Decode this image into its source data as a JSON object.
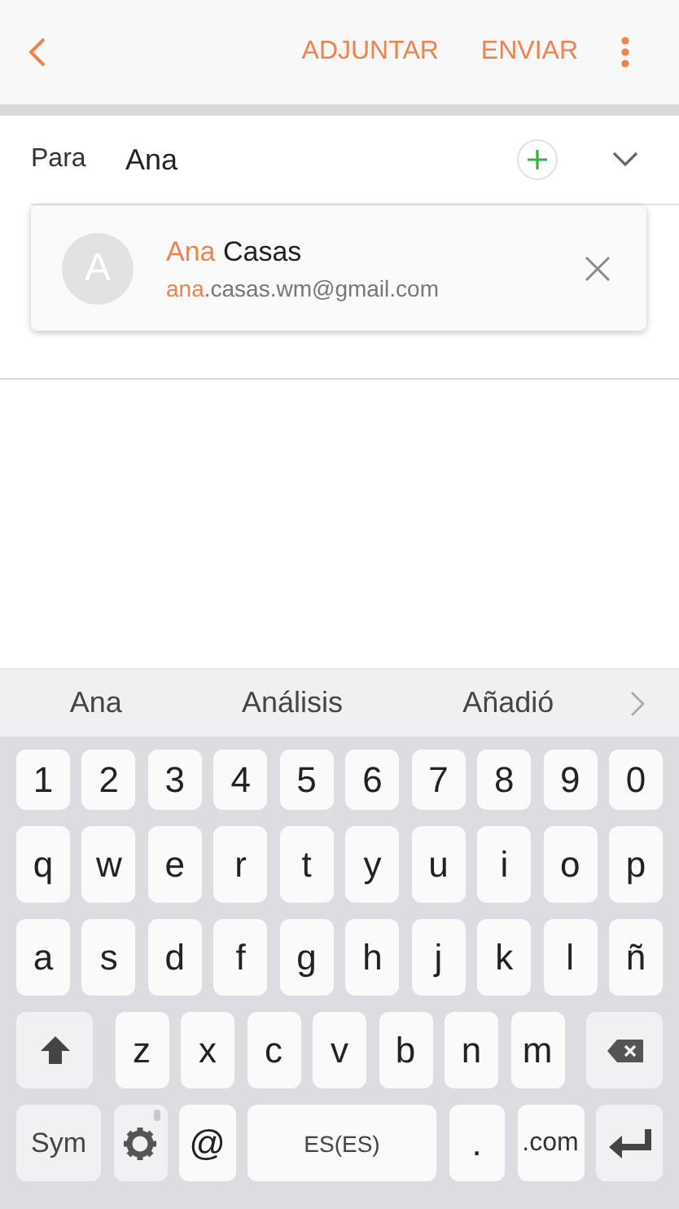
{
  "header": {
    "actions": [
      "ADJUNTAR",
      "ENVIAR"
    ]
  },
  "to": {
    "label": "Para",
    "value": "Ana"
  },
  "suggestion_card": {
    "initial": "A",
    "name_parts": [
      {
        "text": "Ana",
        "highlight": true
      },
      {
        "text": " Casas",
        "highlight": false
      }
    ],
    "email_parts": [
      {
        "text": "ana",
        "highlight": true
      },
      {
        "text": ".casas.wm@gmail.com",
        "highlight": false
      }
    ]
  },
  "predictions": [
    "Ana",
    "Análisis",
    "Añadió"
  ],
  "keyboard": [
    [
      {
        "kind": "num",
        "label": "1"
      },
      {
        "kind": "num",
        "label": "2"
      },
      {
        "kind": "num",
        "label": "3"
      },
      {
        "kind": "num",
        "label": "4"
      },
      {
        "kind": "num",
        "label": "5"
      },
      {
        "kind": "num",
        "label": "6"
      },
      {
        "kind": "num",
        "label": "7"
      },
      {
        "kind": "num",
        "label": "8"
      },
      {
        "kind": "num",
        "label": "9"
      },
      {
        "kind": "num",
        "label": "0"
      }
    ],
    [
      {
        "kind": "char",
        "label": "q"
      },
      {
        "kind": "char",
        "label": "w"
      },
      {
        "kind": "char",
        "label": "e"
      },
      {
        "kind": "char",
        "label": "r"
      },
      {
        "kind": "char",
        "label": "t"
      },
      {
        "kind": "char",
        "label": "y"
      },
      {
        "kind": "char",
        "label": "u"
      },
      {
        "kind": "char",
        "label": "i"
      },
      {
        "kind": "char",
        "label": "o"
      },
      {
        "kind": "char",
        "label": "p"
      }
    ],
    [
      {
        "kind": "char",
        "label": "a"
      },
      {
        "kind": "char",
        "label": "s"
      },
      {
        "kind": "char",
        "label": "d"
      },
      {
        "kind": "char",
        "label": "f"
      },
      {
        "kind": "char",
        "label": "g"
      },
      {
        "kind": "char",
        "label": "h"
      },
      {
        "kind": "char",
        "label": "j"
      },
      {
        "kind": "char",
        "label": "k"
      },
      {
        "kind": "char",
        "label": "l"
      },
      {
        "kind": "char",
        "label": "ñ"
      }
    ],
    [
      {
        "kind": "shift"
      },
      {
        "kind": "char",
        "label": "z"
      },
      {
        "kind": "char",
        "label": "x"
      },
      {
        "kind": "char",
        "label": "c"
      },
      {
        "kind": "char",
        "label": "v"
      },
      {
        "kind": "char",
        "label": "b"
      },
      {
        "kind": "char",
        "label": "n"
      },
      {
        "kind": "char",
        "label": "m"
      },
      {
        "kind": "backspace"
      }
    ],
    [
      {
        "kind": "sym",
        "label": "Sym"
      },
      {
        "kind": "settings"
      },
      {
        "kind": "char",
        "label": "@"
      },
      {
        "kind": "space",
        "label": "ES(ES)"
      },
      {
        "kind": "char",
        "label": "."
      },
      {
        "kind": "dotcom",
        "label": ".com"
      },
      {
        "kind": "enter"
      }
    ]
  ]
}
